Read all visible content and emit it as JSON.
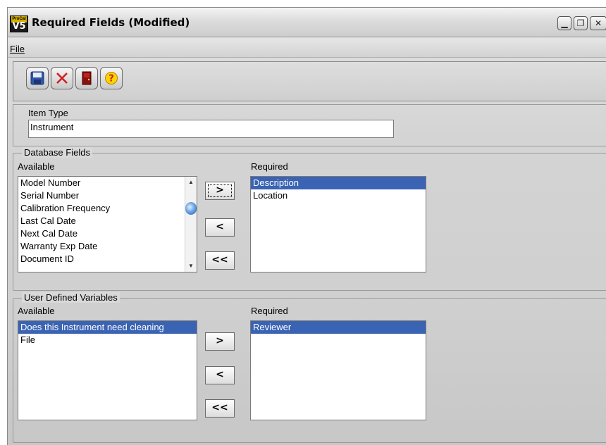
{
  "window": {
    "title": "Required Fields (Modified)",
    "app_icon_top": "ProCal",
    "app_icon_bottom": "V5"
  },
  "menu": {
    "file_label": "File"
  },
  "toolbar": {
    "buttons": [
      "save-icon",
      "delete-icon",
      "close-door-icon",
      "help-icon"
    ]
  },
  "item_type": {
    "label": "Item Type",
    "value": "Instrument"
  },
  "database_fields": {
    "group_title": "Database Fields",
    "available_label": "Available",
    "required_label": "Required",
    "available_items": [
      "Model Number",
      "Serial Number",
      "Calibration Frequency",
      "Last Cal Date",
      "Next Cal Date",
      "Warranty Exp Date",
      "Document ID"
    ],
    "required_items": [
      "Description",
      "Location"
    ],
    "selected_required": "Description"
  },
  "user_defined": {
    "group_title": "User Defined Variables",
    "available_label": "Available",
    "required_label": "Required",
    "available_items": [
      "Does this Instrument need cleaning",
      "File"
    ],
    "required_items": [
      "Reviewer"
    ],
    "selected_available": "Does this Instrument need cleaning",
    "selected_required": "Reviewer"
  },
  "move_buttons": {
    "add": ">",
    "remove": "<",
    "remove_all": "<<"
  }
}
